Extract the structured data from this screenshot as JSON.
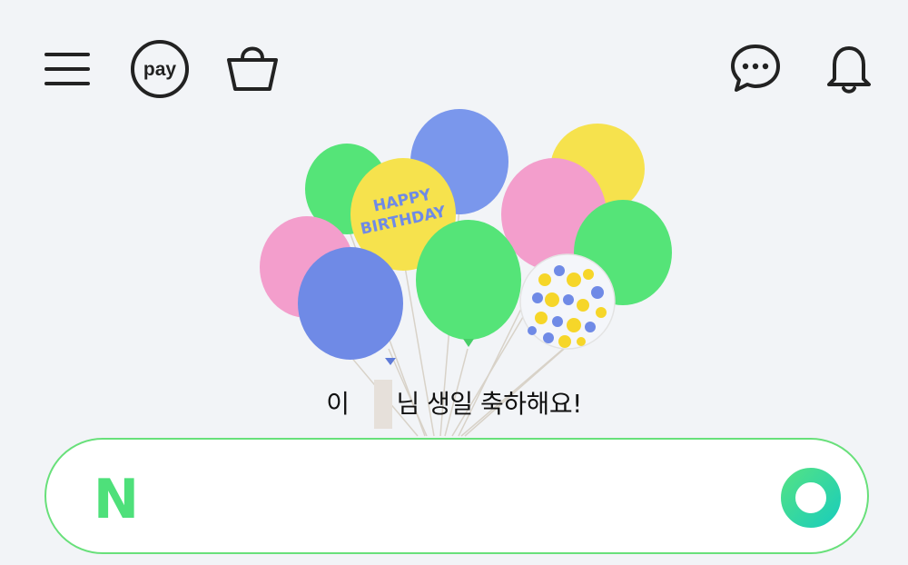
{
  "header": {
    "icons": [
      "menu-icon",
      "pay-icon",
      "shopping-bag-icon",
      "talk-icon",
      "bell-icon"
    ],
    "pay_label": "pay"
  },
  "birthday": {
    "balloon_text_line1": "HAPPY",
    "balloon_text_line2": "BIRTHDAY",
    "greeting_prefix": "이",
    "greeting_suffix": "님 생일 축하해요!"
  },
  "search": {
    "logo_letter": "N",
    "placeholder": "",
    "value": "",
    "accent_color": "#03c75a",
    "border_color": "#68e07a"
  }
}
